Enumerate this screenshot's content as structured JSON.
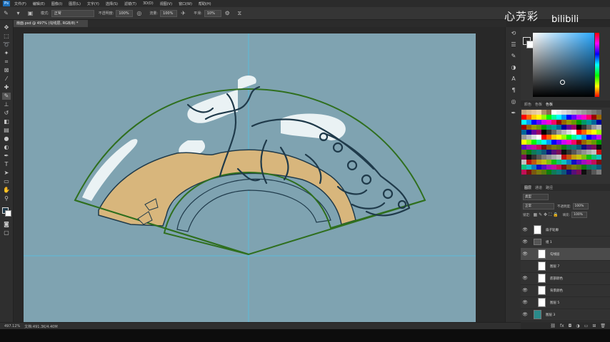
{
  "app": {
    "menu": [
      "文件(F)",
      "编辑(E)",
      "图像(I)",
      "图层(L)",
      "文字(Y)",
      "选择(S)",
      "滤镜(T)",
      "3D(D)",
      "视图(V)",
      "窗口(W)",
      "帮助(H)"
    ],
    "ps_logo": "Ps"
  },
  "options_bar": {
    "mode_label": "模式:",
    "mode_value": "正常",
    "opacity_label": "不透明度:",
    "opacity_value": "100%",
    "flow_label": "流量:",
    "flow_value": "100%",
    "smooth_label": "平滑:",
    "smooth_value": "10%"
  },
  "watermark": {
    "text": "心芳彩",
    "site": "bilibili"
  },
  "document": {
    "tab_title": "扇面.psd @ 497% (勾线层, RGB/8) *"
  },
  "status": {
    "zoom": "497.12%",
    "doc_size": "文档:491.3K/4.40M"
  },
  "panels": {
    "swatch_tabs": [
      "颜色",
      "色板",
      "色板"
    ],
    "layers_tabs": [
      "图层",
      "通道",
      "路径"
    ],
    "filter_value": "类型",
    "blend_value": "正常",
    "opacity_label": "不透明度:",
    "opacity_value": "100%",
    "fill_label": "填充:",
    "fill_value": "100%",
    "lock_label": "锁定:"
  },
  "layers": [
    {
      "name": "扇子轮廓",
      "selected": false
    },
    {
      "name": "组 1",
      "selected": false
    },
    {
      "name": "勾线层",
      "selected": true
    },
    {
      "name": "图层 7",
      "selected": false
    },
    {
      "name": "底部颜色",
      "selected": false
    },
    {
      "name": "背景颜色",
      "selected": false
    },
    {
      "name": "图层 5",
      "selected": false
    },
    {
      "name": "图层 3",
      "selected": false
    }
  ],
  "colors": {
    "canvas_bg": "#7fa3b1",
    "fan_outline": "#2f6f1e",
    "tan": "#d8b67c",
    "sketch": "#1f3a4a"
  }
}
